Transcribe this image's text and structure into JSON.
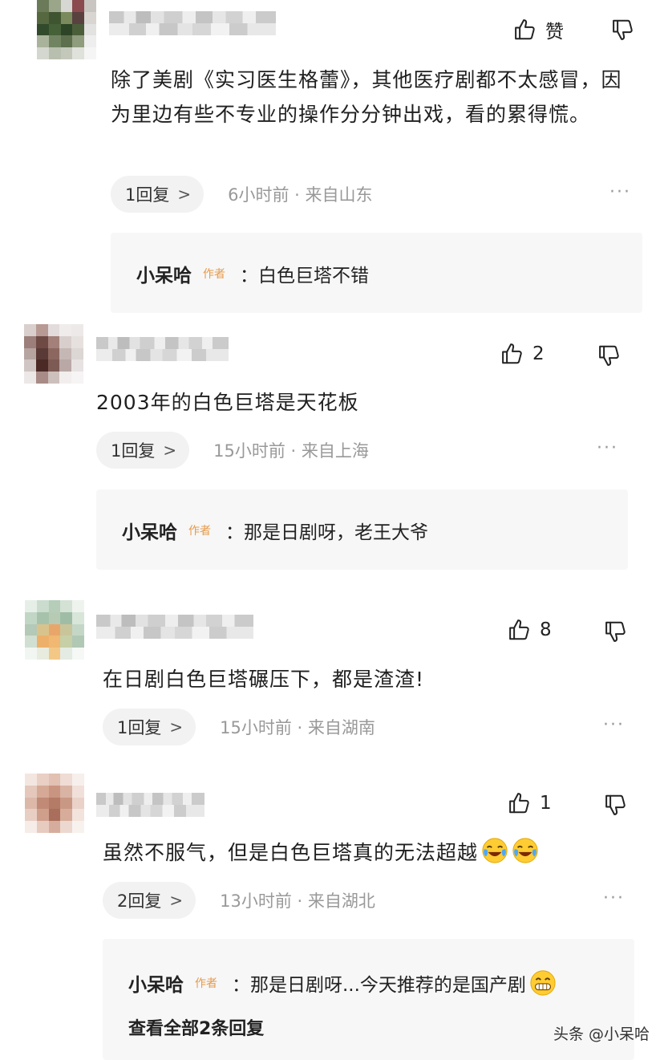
{
  "comments": [
    {
      "like_label": "赞",
      "text": "除了美剧《实习医生格蕾》，其他医疗剧都不太感冒，因为里边有些不专业的操作分分钟出戏，看的累得慌。",
      "reply_label": "1回复",
      "time_location": "6小时前 · 来自山东",
      "sub_reply": {
        "author": "小呆哈",
        "tag": "作者",
        "text": "：白色巨塔不错"
      }
    },
    {
      "like_label": "2",
      "text": "2003年的白色巨塔是天花板",
      "reply_label": "1回复",
      "time_location": "15小时前 · 来自上海",
      "sub_reply": {
        "author": "小呆哈",
        "tag": "作者",
        "text": "：那是日剧呀，老王大爷"
      }
    },
    {
      "like_label": "8",
      "text": "在日剧白色巨塔碾压下，都是渣渣!",
      "reply_label": "1回复",
      "time_location": "15小时前 · 来自湖南"
    },
    {
      "like_label": "1",
      "text": "虽然不服气，但是白色巨塔真的无法超越",
      "emoji": [
        "laugh-cry-emoji",
        "laugh-cry-emoji"
      ],
      "reply_label": "2回复",
      "time_location": "13小时前 · 来自湖北",
      "sub_reply": {
        "author": "小呆哈",
        "tag": "作者",
        "text": "：那是日剧呀...今天推荐的是国产剧",
        "emoji": "grin-emoji"
      },
      "view_all": "查看全部2条回复"
    }
  ],
  "more_label": "···",
  "watermark": "头条 @小呆哈",
  "colors": {
    "author_tag": "#e59a4a",
    "meta": "#999999",
    "pill_bg": "#f2f2f2",
    "sub_bg": "#f7f7f7"
  },
  "icons": [
    "thumb-up-icon",
    "thumb-down-icon",
    "chevron-right-icon",
    "more-icon"
  ]
}
